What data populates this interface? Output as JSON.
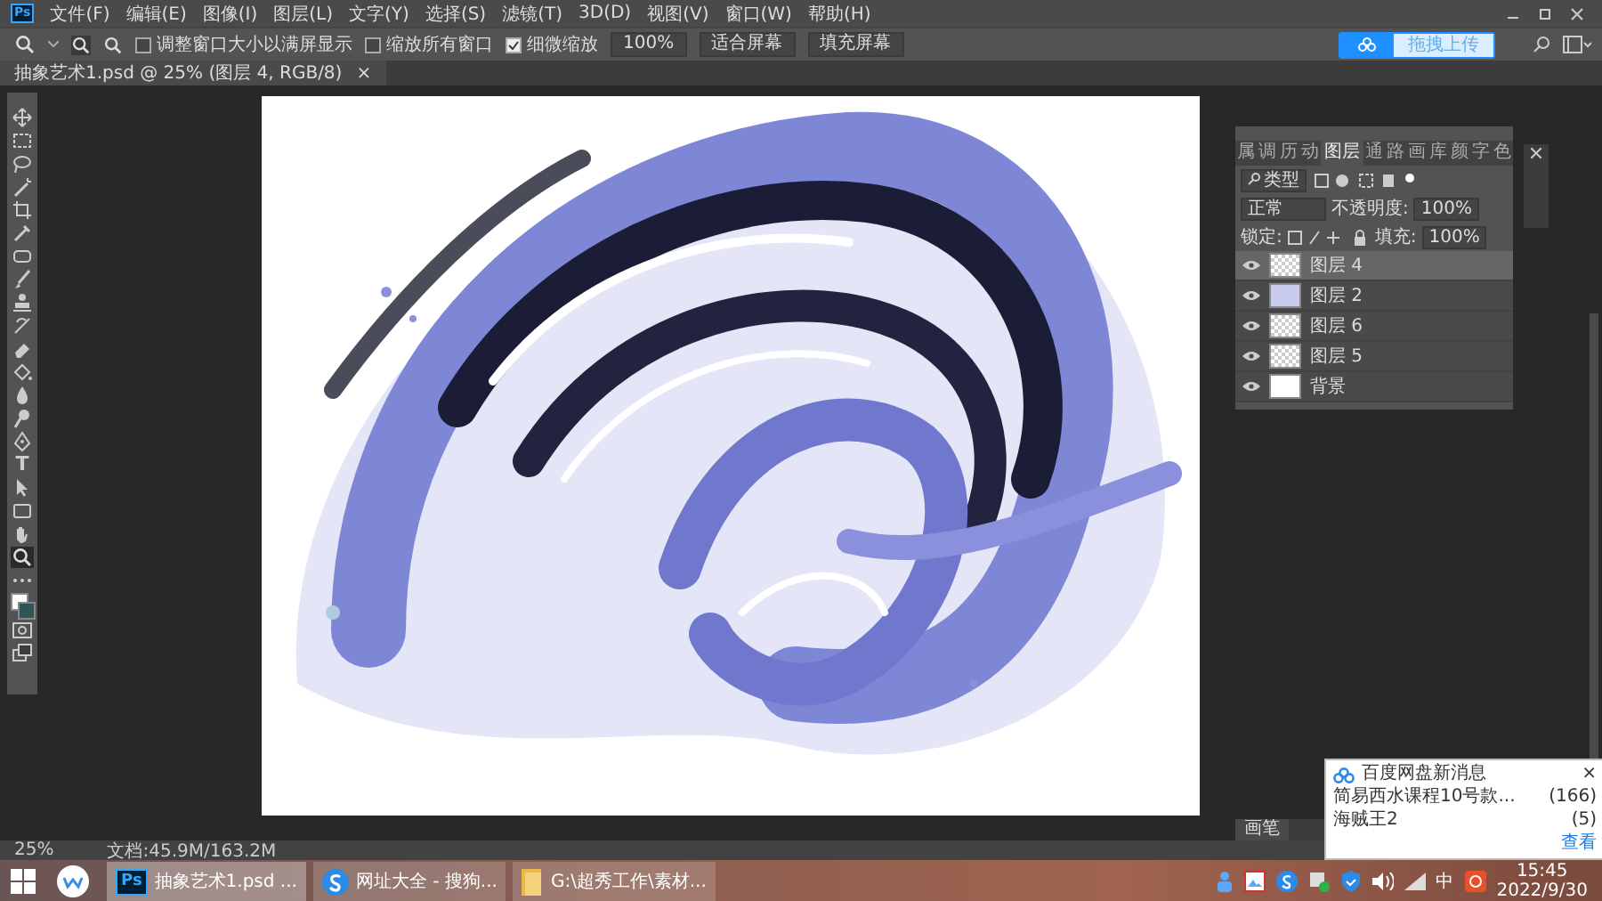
{
  "app": {
    "logo": "Ps"
  },
  "menu": [
    "文件(F)",
    "编辑(E)",
    "图像(I)",
    "图层(L)",
    "文字(Y)",
    "选择(S)",
    "滤镜(T)",
    "3D(D)",
    "视图(V)",
    "窗口(W)",
    "帮助(H)"
  ],
  "options": {
    "checkboxes": [
      {
        "label": "调整窗口大小以满屏显示",
        "checked": false
      },
      {
        "label": "缩放所有窗口",
        "checked": false
      },
      {
        "label": "细微缩放",
        "checked": true
      }
    ],
    "zoom_field": "100%",
    "buttons": [
      "适合屏幕",
      "填充屏幕"
    ],
    "upload_button": "拖拽上传"
  },
  "document_tab": {
    "title": "抽象艺术1.psd @ 25% (图层 4, RGB/8)",
    "close": "×"
  },
  "tools": [
    {
      "kind": "move",
      "selected": false
    },
    {
      "kind": "marquee",
      "selected": false
    },
    {
      "kind": "lasso",
      "selected": false
    },
    {
      "kind": "wand",
      "selected": false
    },
    {
      "kind": "crop",
      "selected": false
    },
    {
      "kind": "eyedropper",
      "selected": false
    },
    {
      "kind": "frame",
      "selected": false
    },
    {
      "kind": "brush",
      "selected": false
    },
    {
      "kind": "stamp",
      "selected": false
    },
    {
      "kind": "history",
      "selected": false
    },
    {
      "kind": "eraser",
      "selected": false
    },
    {
      "kind": "bucket",
      "selected": false
    },
    {
      "kind": "blur",
      "selected": false
    },
    {
      "kind": "dodge",
      "selected": false
    },
    {
      "kind": "pen",
      "selected": false
    },
    {
      "kind": "type",
      "glyph": "T",
      "selected": false
    },
    {
      "kind": "arrow",
      "selected": false
    },
    {
      "kind": "rect",
      "selected": false
    },
    {
      "kind": "hand",
      "selected": false
    },
    {
      "kind": "zoom",
      "selected": true
    },
    {
      "kind": "more",
      "selected": false
    },
    {
      "kind": "colors",
      "selected": false
    },
    {
      "kind": "mask",
      "selected": false
    },
    {
      "kind": "screen",
      "selected": false
    }
  ],
  "layers_panel": {
    "tabs": [
      {
        "label": "属",
        "selected": false
      },
      {
        "label": "调",
        "selected": false
      },
      {
        "label": "历",
        "selected": false
      },
      {
        "label": "动",
        "selected": false
      },
      {
        "label": "图层",
        "selected": true
      },
      {
        "label": "通",
        "selected": false
      },
      {
        "label": "路",
        "selected": false
      },
      {
        "label": "画",
        "selected": false
      },
      {
        "label": "库",
        "selected": false
      },
      {
        "label": "颜",
        "selected": false
      },
      {
        "label": "字",
        "selected": false
      },
      {
        "label": "色",
        "selected": false
      }
    ],
    "filter": "类型",
    "blend_mode": "正常",
    "opacity_label": "不透明度:",
    "opacity": "100%",
    "lock_label": "锁定:",
    "fill_label": "填充:",
    "fill": "100%",
    "layers": [
      {
        "name": "图层 4",
        "kind": "transparent",
        "visible": true,
        "selected": true
      },
      {
        "name": "图层 2",
        "kind": "art",
        "visible": true,
        "selected": false
      },
      {
        "name": "图层 6",
        "kind": "transparent",
        "visible": true,
        "selected": false
      },
      {
        "name": "图层 5",
        "kind": "transparent",
        "visible": true,
        "selected": false
      },
      {
        "name": "背景",
        "kind": "white",
        "visible": true,
        "selected": false
      }
    ]
  },
  "brush_panel": {
    "tab": "画笔"
  },
  "status_bar": {
    "zoom": "25%",
    "doc_size": "文档:45.9M/163.2M"
  },
  "notification": {
    "title": "百度网盘新消息",
    "close": "×",
    "items": [
      {
        "name": "简易西水课程10号款...",
        "count": "(166)"
      },
      {
        "name": "海贼王2",
        "count": "(5)"
      }
    ],
    "link": "查看"
  },
  "taskbar": {
    "apps": [
      {
        "kind": "photoshop",
        "glyph": "Ps",
        "label": "抽象艺术1.psd ...",
        "selected": true
      },
      {
        "kind": "browser",
        "label": "网址大全 - 搜狗...",
        "selected": false
      },
      {
        "kind": "folder",
        "label": "G:\\超秀工作\\素材...",
        "selected": false
      }
    ],
    "ime": "中",
    "time": "15:45",
    "date": "2022/9/30"
  }
}
